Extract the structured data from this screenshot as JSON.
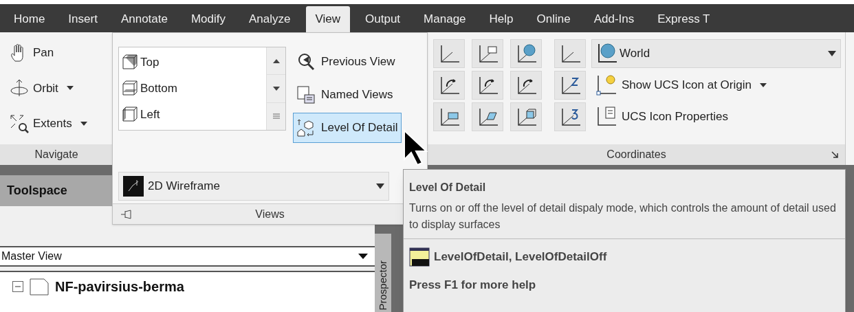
{
  "tabs": [
    {
      "label": "Home",
      "selected": false
    },
    {
      "label": "Insert",
      "selected": false
    },
    {
      "label": "Annotate",
      "selected": false
    },
    {
      "label": "Modify",
      "selected": false
    },
    {
      "label": "Analyze",
      "selected": false
    },
    {
      "label": "View",
      "selected": true
    },
    {
      "label": "Output",
      "selected": false
    },
    {
      "label": "Manage",
      "selected": false
    },
    {
      "label": "Help",
      "selected": false
    },
    {
      "label": "Online",
      "selected": false
    },
    {
      "label": "Add-Ins",
      "selected": false
    },
    {
      "label": "Express T",
      "selected": false
    }
  ],
  "navigate_panel": {
    "title": "Navigate",
    "items": [
      {
        "kind": "pan",
        "label": "Pan",
        "dropdown": false
      },
      {
        "kind": "orbit",
        "label": "Orbit",
        "dropdown": true
      },
      {
        "kind": "extents",
        "label": "Extents",
        "dropdown": true
      }
    ]
  },
  "views_panel": {
    "title": "Views",
    "view_list": [
      "Top",
      "Bottom",
      "Left"
    ],
    "buttons": [
      {
        "kind": "previous",
        "label": "Previous View",
        "selected": false
      },
      {
        "kind": "named",
        "label": "Named Views",
        "selected": false
      },
      {
        "kind": "detail",
        "label": "Level Of Detail",
        "selected": true
      }
    ],
    "visual_style": "2D Wireframe"
  },
  "coordinates_panel": {
    "title": "Coordinates",
    "ucs_dropdown": "World",
    "actions": [
      {
        "label": "Show UCS Icon at Origin",
        "dropdown": true
      },
      {
        "label": "UCS Icon Properties",
        "dropdown": false
      }
    ]
  },
  "toolspace": {
    "title": "Toolspace",
    "view_dropdown": "Master View",
    "tree": [
      {
        "label": "NF-pavirsius-berma",
        "expanded": true
      }
    ],
    "side_tab": "Prospector"
  },
  "tooltip": {
    "title": "Level Of Detail",
    "description": "Turns on or off the level of detail dispaly mode, which controls the amount of detail used to display surfaces",
    "commands": "LevelOfDetail, LevelOfDetailOff",
    "help": "Press F1 for more help"
  }
}
